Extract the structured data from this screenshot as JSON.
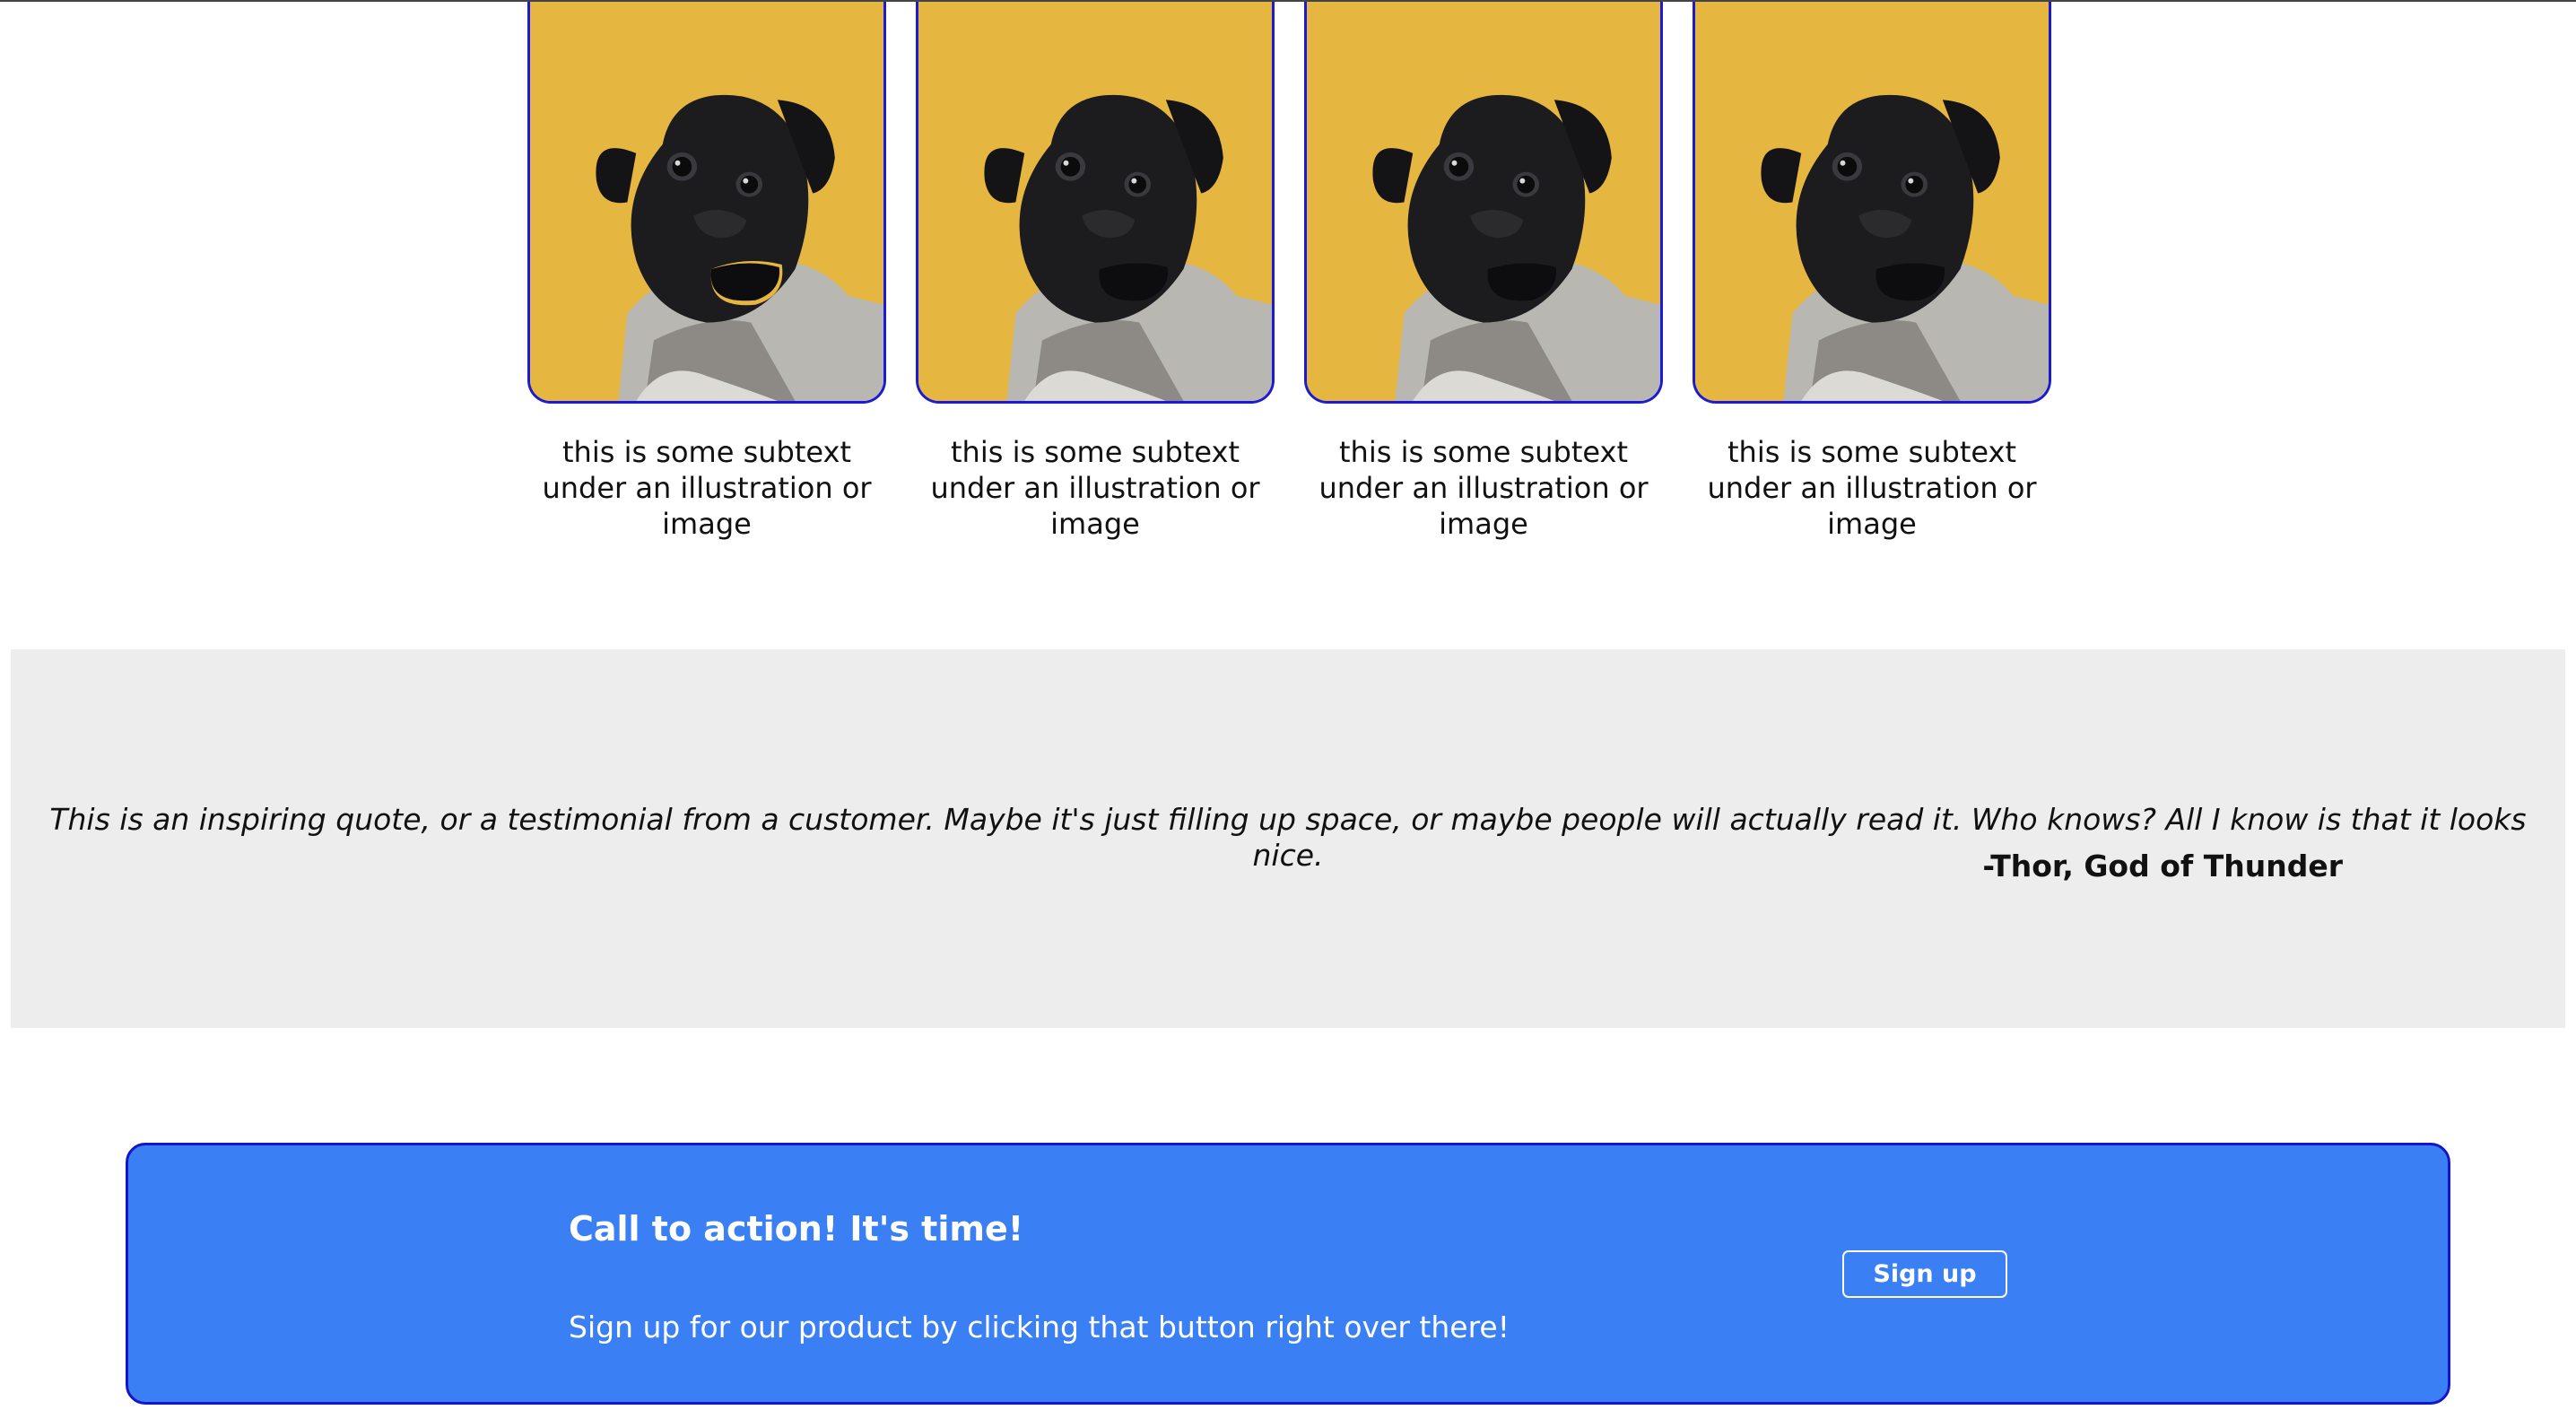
{
  "cards": [
    {
      "image": "pug-in-sweater-photo",
      "caption": "this is some subtext under an illustration or image"
    },
    {
      "image": "pug-in-sweater-photo",
      "caption": "this is some subtext under an illustration or image"
    },
    {
      "image": "pug-in-sweater-photo",
      "caption": "this is some subtext under an illustration or image"
    },
    {
      "image": "pug-in-sweater-photo",
      "caption": "this is some subtext under an illustration or image"
    }
  ],
  "quote": {
    "text": "This is an inspiring quote, or a testimonial from a customer. Maybe it's just filling up space, or maybe people will actually read it. Who knows? All I know is that it looks nice.",
    "author": "-Thor, God of Thunder"
  },
  "cta": {
    "title": "Call to action! It's time!",
    "subtitle": "Sign up for our product by clicking that button right over there!",
    "button_label": "Sign up"
  },
  "colors": {
    "card_border": "#1b1bd6",
    "image_background": "#e5b640",
    "quote_background": "#ededed",
    "cta_background": "#3b7ff5",
    "cta_border": "#1515c9"
  }
}
